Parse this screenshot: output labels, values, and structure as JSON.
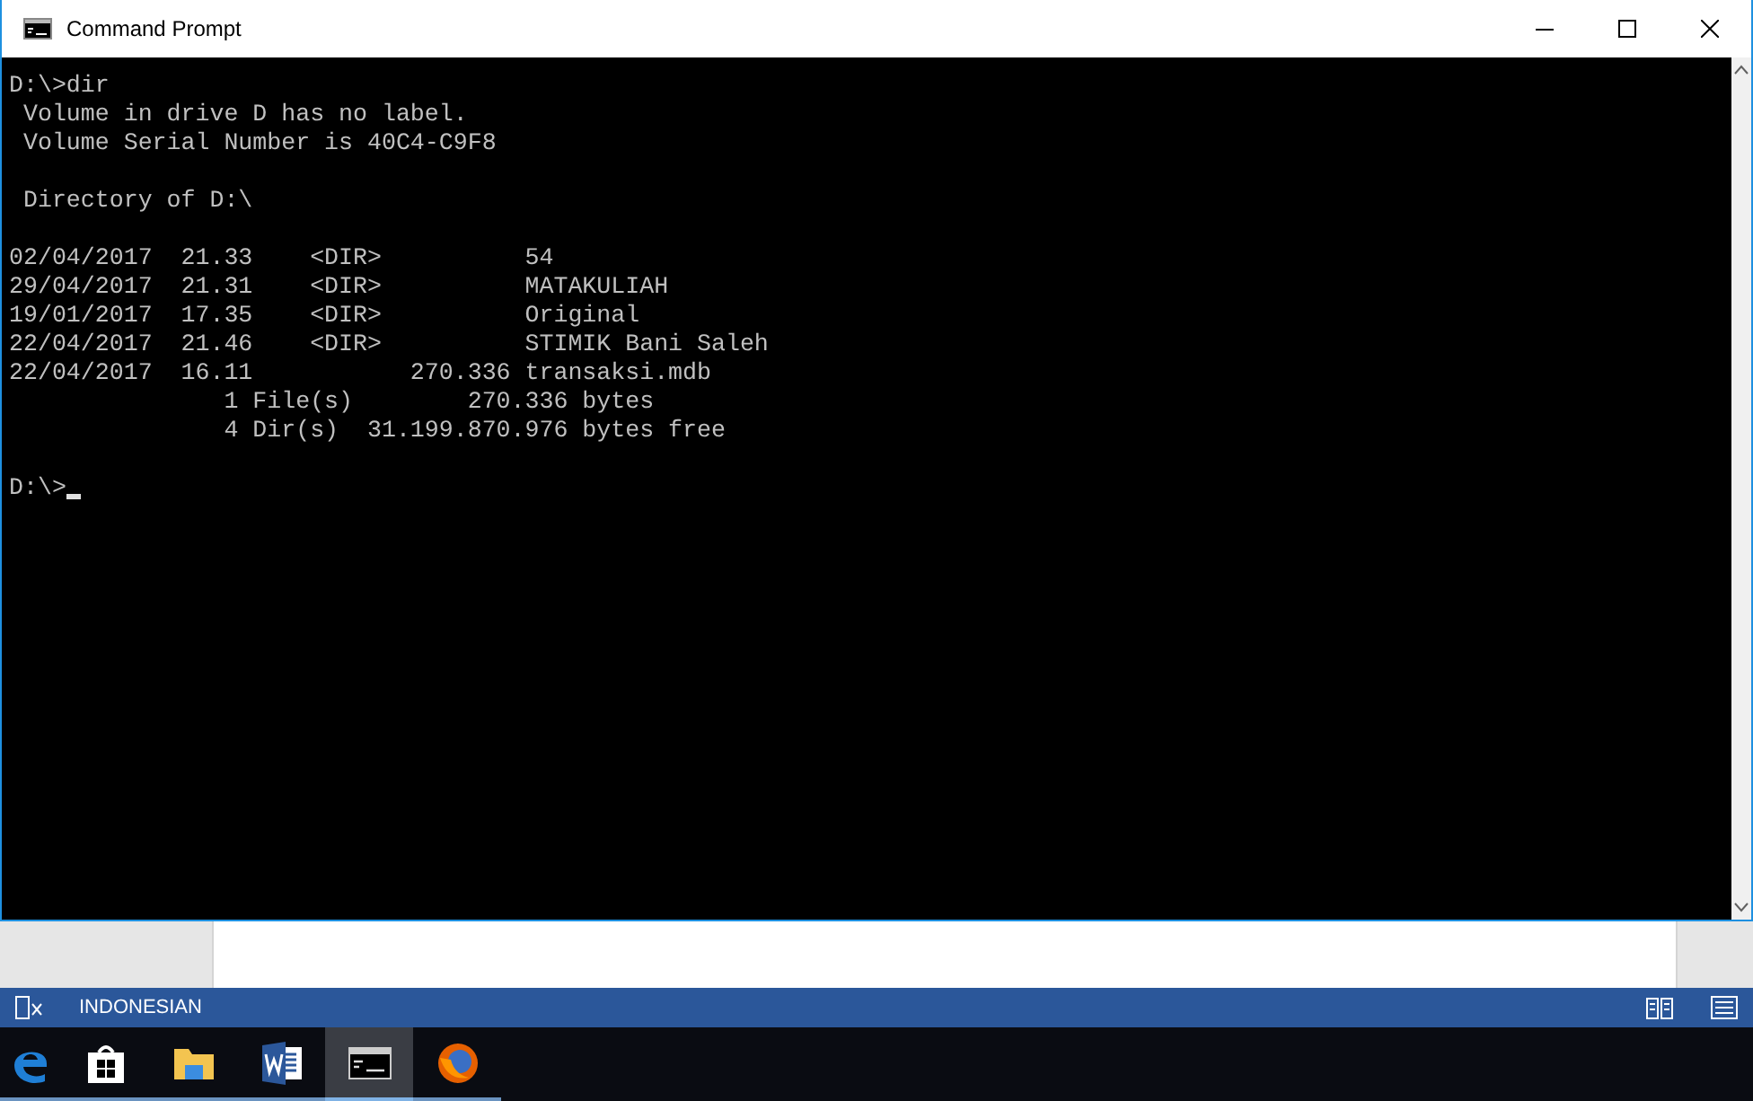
{
  "window": {
    "title": "Command Prompt"
  },
  "console": {
    "blocks": [
      [
        "D:\\>dir",
        " Volume in drive D has no label.",
        " Volume Serial Number is 40C4-C9F8"
      ],
      [
        " Directory of D:\\"
      ],
      [
        "02/04/2017  21.33    <DIR>          54",
        "29/04/2017  21.31    <DIR>          MATAKULIAH",
        "19/01/2017  17.35    <DIR>          Original",
        "22/04/2017  21.46    <DIR>          STIMIK Bani Saleh",
        "22/04/2017  16.11           270.336 transaksi.mdb",
        "               1 File(s)        270.336 bytes",
        "               4 Dir(s)  31.199.870.976 bytes free"
      ]
    ],
    "prompt": "D:\\>"
  },
  "word_status_bar": {
    "language": "INDONESIAN"
  },
  "taskbar": {
    "apps": [
      {
        "kind": "edge",
        "selected": false
      },
      {
        "kind": "store",
        "selected": false
      },
      {
        "kind": "explorer",
        "selected": false
      },
      {
        "kind": "word",
        "selected": false
      },
      {
        "kind": "cmd",
        "selected": true
      },
      {
        "kind": "firefox",
        "selected": false
      }
    ]
  }
}
